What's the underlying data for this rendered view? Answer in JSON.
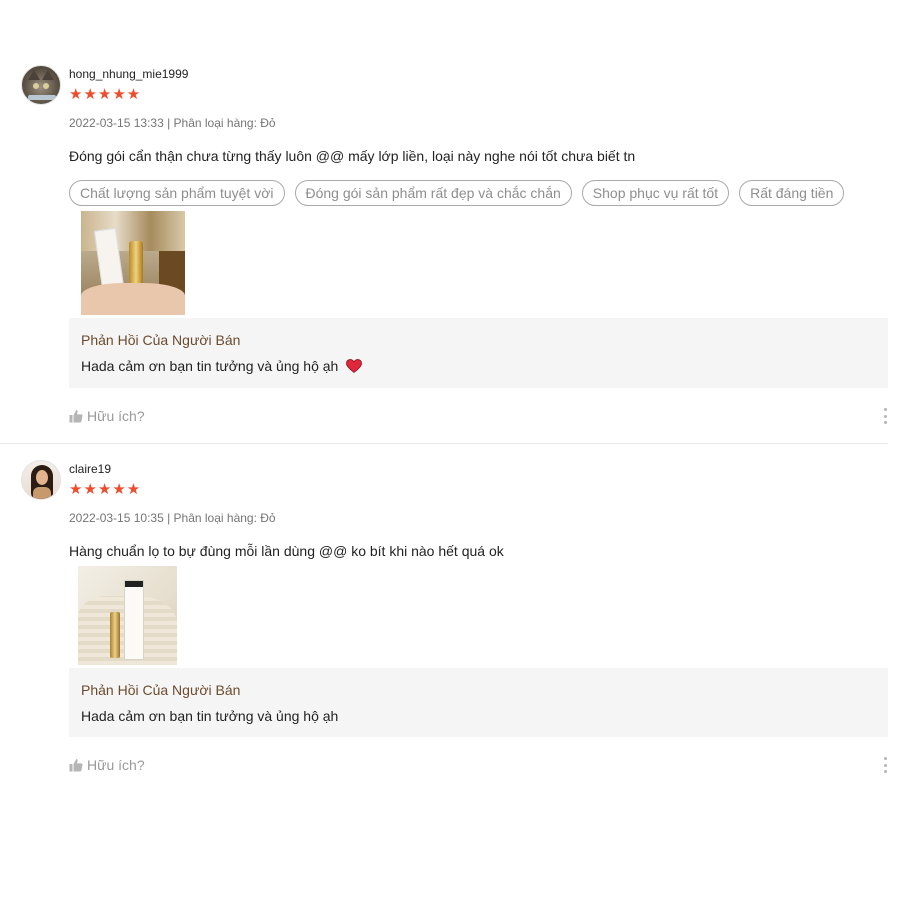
{
  "reviews": [
    {
      "username": "hong_nhung_mie1999",
      "stars": "★★★★★",
      "meta": "2022-03-15 13:33 | Phân loại hàng: Đỏ",
      "comment": "Đóng gói cẩn thận chưa từng thấy luôn @@ mấy lớp liền, loại này nghe nói tốt chưa biết tn",
      "tags": [
        "Chất lượng sản phẩm tuyệt vời",
        "Đóng gói sản phẩm rất đẹp và chắc chắn",
        "Shop phục vụ rất tốt",
        "Rất đáng tiền"
      ],
      "seller_reply_title": "Phản Hồi Của Người Bán",
      "seller_reply_text": "Hada cảm ơn bạn tin tưởng và ủng hộ ạh",
      "helpful_label": "Hữu ích?",
      "rating": 5
    },
    {
      "username": "claire19",
      "stars": "★★★★★",
      "meta": "2022-03-15 10:35 | Phân loại hàng: Đỏ",
      "comment": "Hàng chuẩn lọ to bự đùng mỗi lần dùng @@ ko bít khi nào hết quá ok",
      "seller_reply_title": "Phản Hồi Của Người Bán",
      "seller_reply_text": "Hada cảm ơn bạn tin tưởng và ủng hộ ạh",
      "helpful_label": "Hữu ích?",
      "rating": 5
    }
  ],
  "colors": {
    "star": "#ee4d2d",
    "reply_title": "#6b4c2d",
    "reply_bg": "#f5f5f5",
    "heart": "#e0263a"
  },
  "icons": {
    "like": "thumbs-up-icon",
    "more": "more-vertical-icon",
    "heart": "heart-icon"
  }
}
